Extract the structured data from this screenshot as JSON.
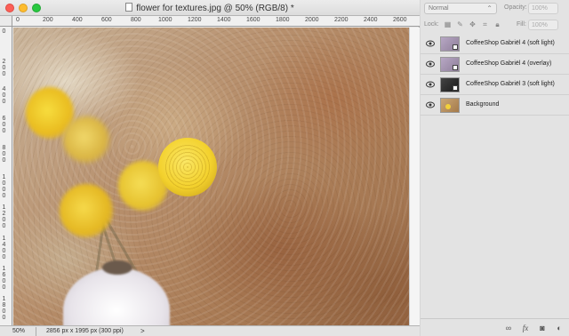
{
  "document": {
    "title": "flower for textures.jpg @ 50% (RGB/8) *",
    "ruler_top_labels": [
      "0",
      "200",
      "400",
      "600",
      "800",
      "1000",
      "1200",
      "1400",
      "1600",
      "1800",
      "2000",
      "2200",
      "2400",
      "2600"
    ],
    "ruler_left_labels": [
      "0",
      "2 0 0",
      "4 0 0",
      "6 0 0",
      "8 0 0",
      "1 0 0 0",
      "1 2 0 0",
      "1 4 0 0",
      "1 6 0 0",
      "1 8 0 0"
    ],
    "status": {
      "zoom": "50%",
      "info": "2856 px x 1995 px (300 ppi)",
      "arrow": ">"
    }
  },
  "layers_panel": {
    "blend_mode": "Normal",
    "opacity_label": "Opacity:",
    "opacity_value": "100%",
    "lock_label": "Lock:",
    "fill_label": "Fill:",
    "fill_value": "100%",
    "layers": [
      {
        "name": "CoffeeShop Gabriël 4 (soft light)",
        "visible": true,
        "thumb": "texture"
      },
      {
        "name": "CoffeeShop Gabriël 4  (overlay)",
        "visible": true,
        "thumb": "texture"
      },
      {
        "name": "CoffeeShop Gabriël 3 (soft light)",
        "visible": true,
        "thumb": "dark"
      },
      {
        "name": "Background",
        "visible": true,
        "thumb": "background"
      }
    ],
    "footer_icons": [
      "link-icon",
      "fx-icon",
      "mask-icon",
      "adjustment-icon"
    ]
  }
}
